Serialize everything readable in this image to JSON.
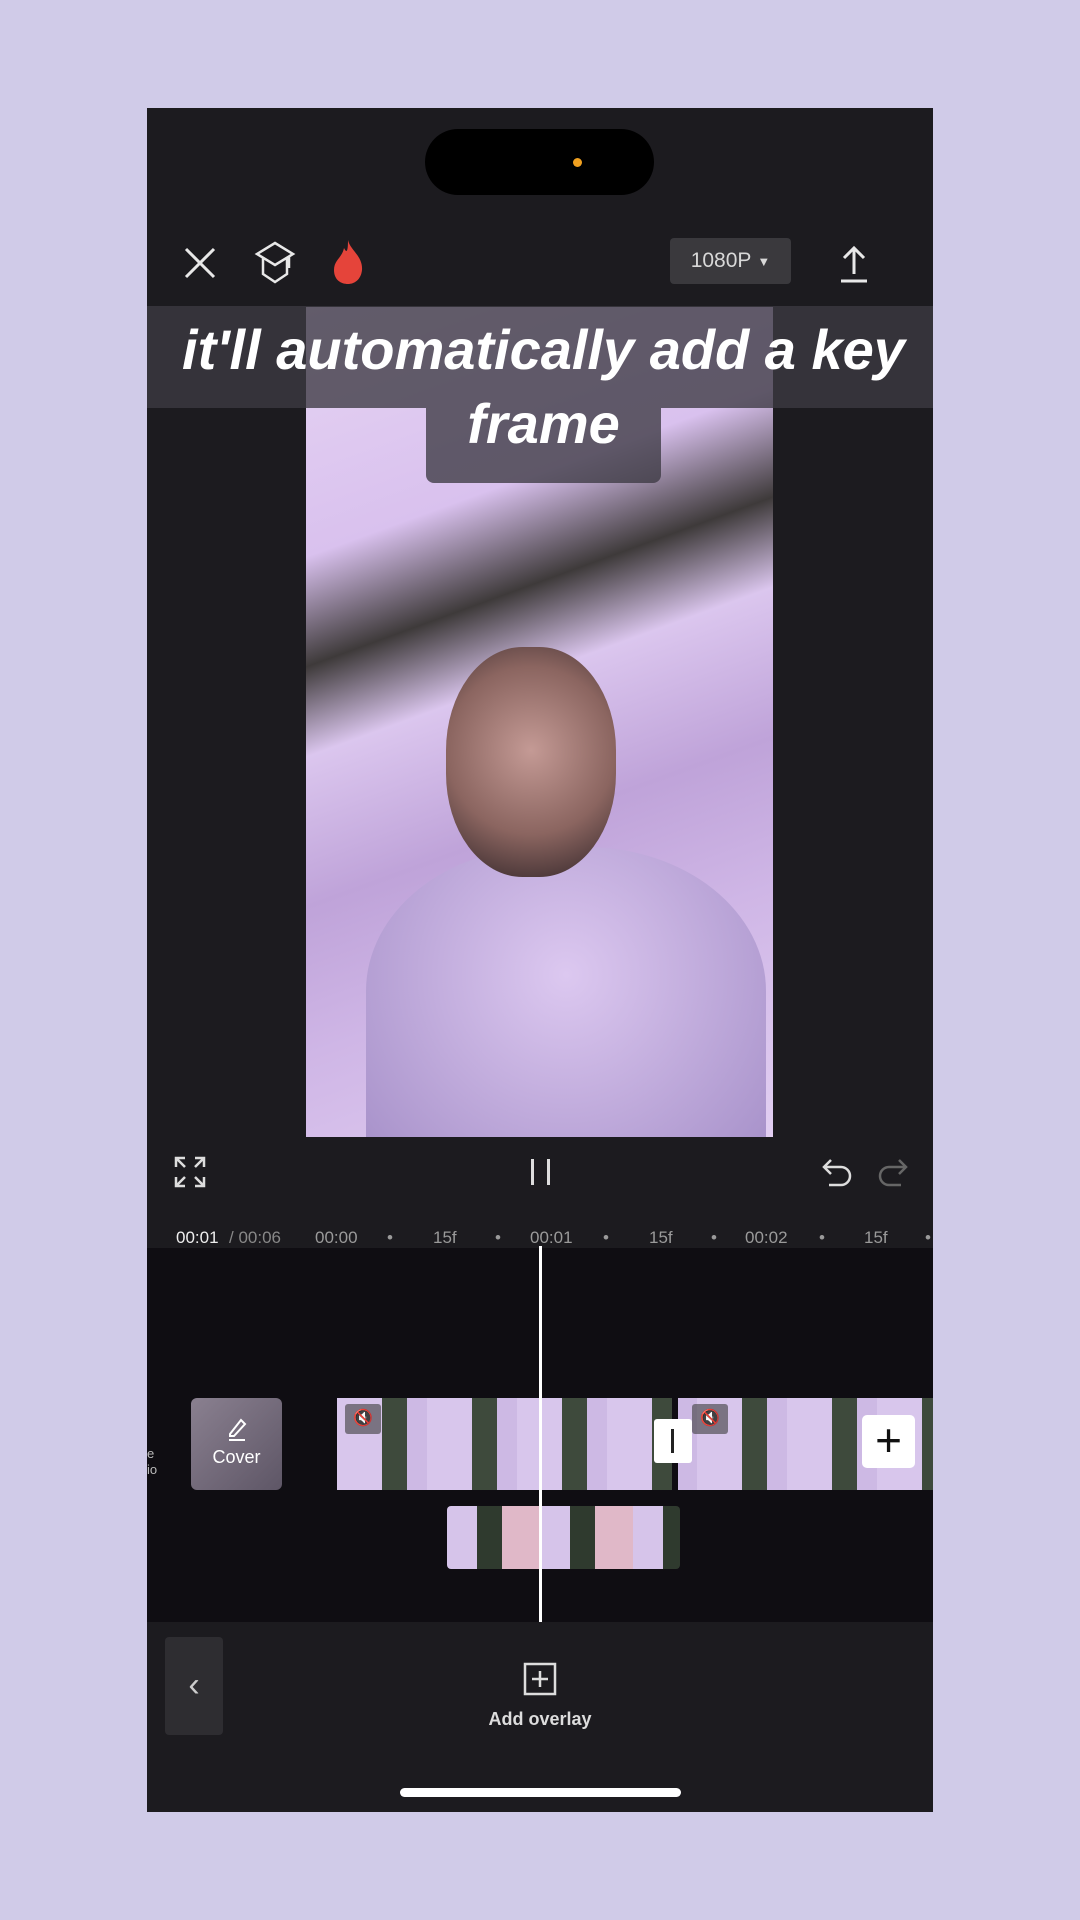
{
  "topbar": {
    "resolution": "1080P",
    "icons": [
      "close-icon",
      "graduation-cap-icon",
      "fire-icon",
      "export-icon"
    ]
  },
  "caption": {
    "line1": "it'll automatically add a key",
    "line2": "frame"
  },
  "timeline": {
    "current_time": "00:01",
    "total_time": "/ 00:06",
    "ticks": [
      "00:00",
      "15f",
      "00:01",
      "15f",
      "00:02",
      "15f"
    ]
  },
  "cover": {
    "label": "Cover"
  },
  "edge_text": "e\nio",
  "bottom": {
    "add_overlay": "Add overlay"
  },
  "colors": {
    "background": "#d0cbe8",
    "panel": "#1c1b1f",
    "flame": "#e5443a"
  }
}
